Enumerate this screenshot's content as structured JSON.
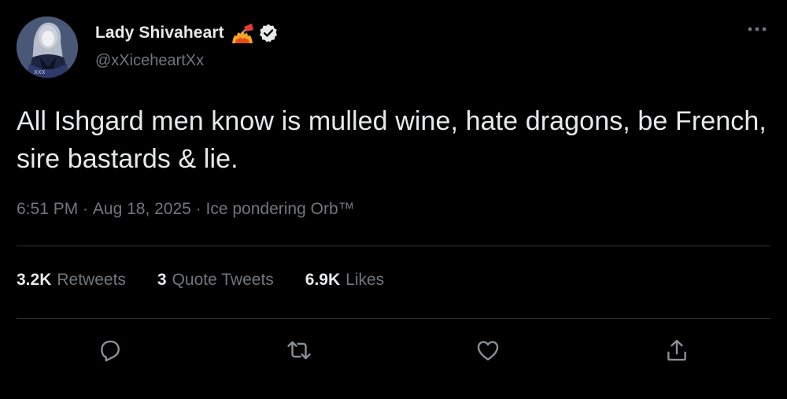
{
  "author": {
    "display_name": "Lady Shivaheart",
    "handle": "@xXiceheartXx",
    "avatar_icon": "avatar-portrait",
    "name_emoji_icon": "flag-on-fire-icon",
    "verified_icon": "verified-badge-icon"
  },
  "tweet": {
    "text": "All Ishgard men know is mulled wine, hate dragons, be French, sire bastards & lie."
  },
  "meta": {
    "time": "6:51 PM",
    "separator": " · ",
    "date": "Aug 18, 2025",
    "source": "Ice pondering Orb™"
  },
  "stats": {
    "retweets": {
      "count": "3.2K",
      "label": "Retweets"
    },
    "quotes": {
      "count": "3",
      "label": "Quote Tweets"
    },
    "likes": {
      "count": "6.9K",
      "label": "Likes"
    }
  },
  "actions": [
    "reply-icon",
    "retweet-icon",
    "like-icon",
    "share-icon"
  ],
  "colors": {
    "background": "#000000",
    "primary_text": "#e7e9ea",
    "secondary_text": "#71767b",
    "divider": "#2f3336",
    "verified_badge": "#e7e9ea"
  }
}
